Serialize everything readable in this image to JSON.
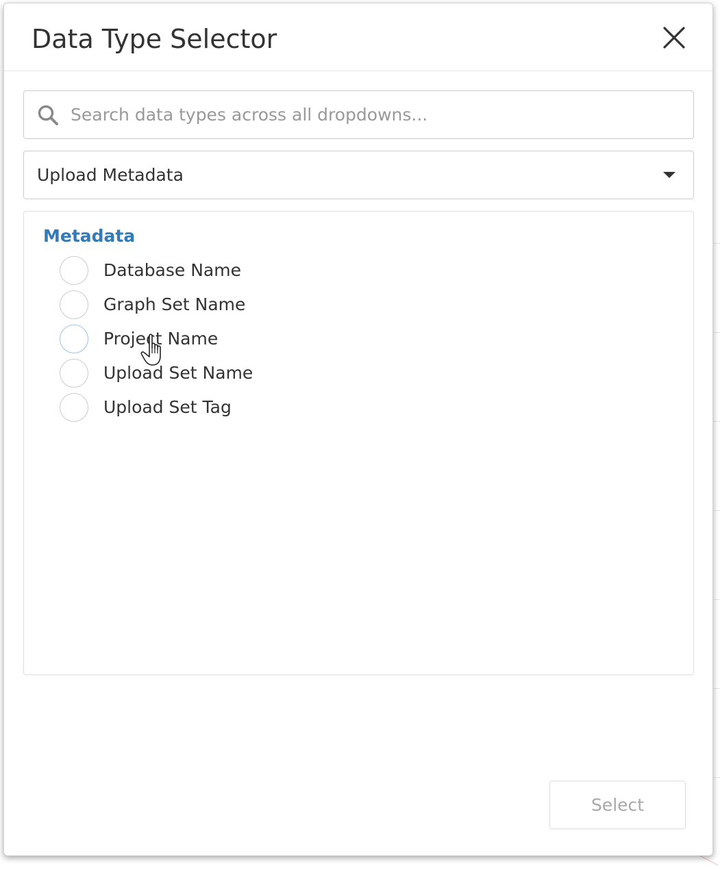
{
  "dialog": {
    "title": "Data Type Selector",
    "close_icon": "close-icon"
  },
  "search": {
    "placeholder": "Search data types across all dropdowns...",
    "value": "",
    "icon": "search-icon"
  },
  "category_select": {
    "selected": "Upload Metadata",
    "icon": "caret-down-icon"
  },
  "list": {
    "group_label": "Metadata",
    "options": [
      {
        "label": "Database Name",
        "selected": false
      },
      {
        "label": "Graph Set Name",
        "selected": false
      },
      {
        "label": "Project Name",
        "selected": false,
        "hovered": true
      },
      {
        "label": "Upload Set Name",
        "selected": false
      },
      {
        "label": "Upload Set Tag",
        "selected": false
      }
    ]
  },
  "footer": {
    "select_label": "Select",
    "select_enabled": false
  },
  "colors": {
    "group_header": "#337ab7",
    "hover_radio_border": "#9fc4e4",
    "disabled_text": "#a8a8a8"
  }
}
